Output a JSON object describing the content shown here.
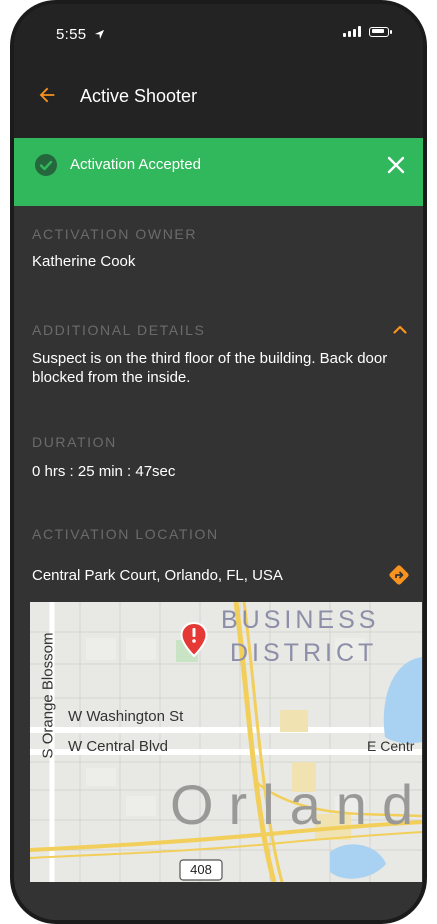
{
  "status_bar": {
    "time": "5:55"
  },
  "header": {
    "title": "Active Shooter"
  },
  "banner": {
    "message": "Activation Accepted",
    "color": "#31b85c"
  },
  "activation_owner": {
    "label": "ACTIVATION OWNER",
    "value": "Katherine Cook"
  },
  "additional_details": {
    "label": "ADDITIONAL DETAILS",
    "value": "Suspect is on the third floor of the building. Back door blocked from the inside."
  },
  "duration": {
    "label": "DURATION",
    "value": "0 hrs : 25 min : 47sec"
  },
  "activation_location": {
    "label": "ACTIVATION LOCATION",
    "value": "Central Park Court, Orlando, FL, USA"
  },
  "map": {
    "district_line1": "BUSINESS",
    "district_line2": "DISTRICT",
    "street_vertical": "S Orange Blossom",
    "street_1": "W Washington St",
    "street_2": "W Central Blvd",
    "street_3": "E Centr",
    "city": "Orland",
    "route_shield": "408"
  },
  "colors": {
    "accent": "#f7931e",
    "background": "#333334",
    "header": "#232323"
  }
}
